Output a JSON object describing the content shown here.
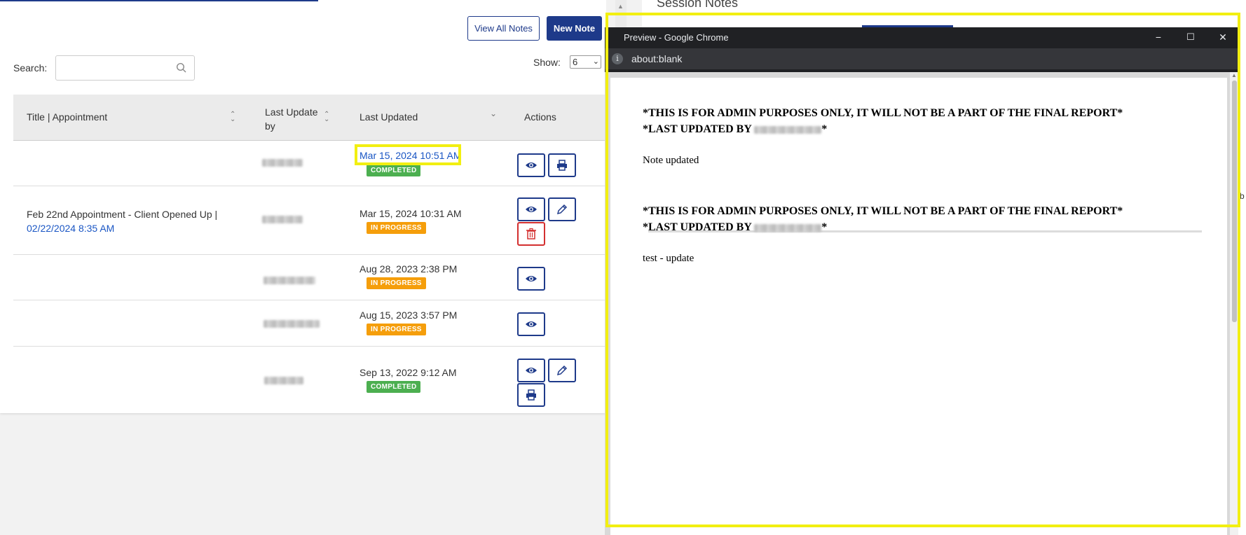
{
  "toolbar": {
    "view_all_label": "View All Notes",
    "new_note_label": "New Note"
  },
  "search": {
    "label": "Search:",
    "value": "",
    "placeholder": ""
  },
  "show": {
    "label": "Show:",
    "selected": "6"
  },
  "table": {
    "headers": {
      "title": "Title | Appointment",
      "last_update_by": "Last Update by",
      "last_updated": "Last Updated",
      "actions": "Actions"
    },
    "rows": [
      {
        "title": "",
        "appointment_link": "",
        "last_updated": "Mar 15, 2024 10:51 AM",
        "status": "COMPLETED",
        "actions": [
          "view",
          "print"
        ]
      },
      {
        "title": "Feb 22nd Appointment - Client Opened Up |",
        "appointment_link": "02/22/2024 8:35 AM",
        "last_updated": "Mar 15, 2024 10:31 AM",
        "status": "IN PROGRESS",
        "actions": [
          "view",
          "edit",
          "delete"
        ]
      },
      {
        "title": "",
        "appointment_link": "",
        "last_updated": "Aug 28, 2023 2:38 PM",
        "status": "IN PROGRESS",
        "actions": [
          "view"
        ]
      },
      {
        "title": "",
        "appointment_link": "",
        "last_updated": "Aug 15, 2023 3:57 PM",
        "status": "IN PROGRESS",
        "actions": [
          "view"
        ]
      },
      {
        "title": "",
        "appointment_link": "",
        "last_updated": "Sep 13, 2022 9:12 AM",
        "status": "COMPLETED",
        "actions": [
          "view",
          "edit",
          "print"
        ]
      }
    ]
  },
  "background": {
    "card_title": "Session Notes",
    "fragment": "b"
  },
  "popup": {
    "title": "Preview - Google Chrome",
    "address": "about:blank",
    "controls": {
      "minimize": "−",
      "maximize": "☐",
      "close": "✕"
    },
    "notes": [
      {
        "admin_line": "*THIS IS FOR ADMIN PURPOSES ONLY, IT WILL NOT BE A PART OF THE FINAL REPORT*",
        "updated_by_prefix": "*LAST UPDATED BY",
        "updated_by_suffix": "*",
        "body": "Note updated"
      },
      {
        "admin_line": "*THIS IS FOR ADMIN PURPOSES ONLY, IT WILL NOT BE A PART OF THE FINAL REPORT*",
        "updated_by_prefix": "*LAST UPDATED BY",
        "updated_by_suffix": "*",
        "body": "test - update"
      }
    ]
  },
  "colors": {
    "primary": "#1e3a8a",
    "completed": "#4caf50",
    "in_progress": "#f59e0b",
    "delete": "#d32f2f",
    "highlight": "#f2ef11",
    "link": "#1a56c4"
  }
}
